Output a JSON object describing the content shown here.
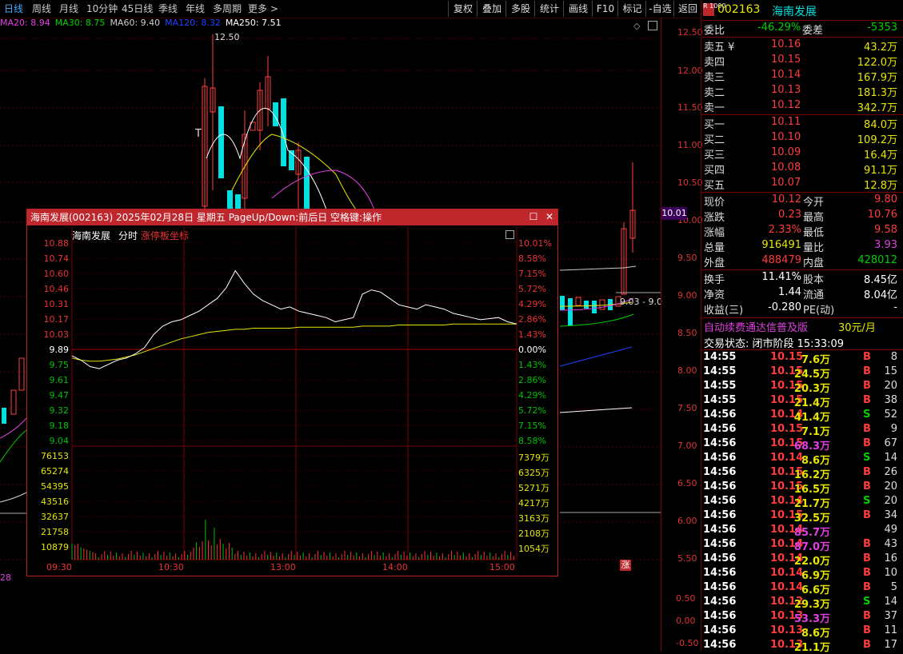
{
  "topbar": {
    "tabs": [
      "日线",
      "周线",
      "月线",
      "10分钟",
      "45日线",
      "季线",
      "年线",
      "多周期",
      "更多 >"
    ],
    "buttons": [
      "复权",
      "叠加",
      "多股",
      "统计",
      "画线",
      "F10",
      "标记",
      "-自选",
      "返回"
    ]
  },
  "ma_legend": [
    {
      "label": "MA20: 8.94",
      "color": "#e040e0"
    },
    {
      "label": "MA30: 8.75",
      "color": "#00d000"
    },
    {
      "label": "MA60: 9.40",
      "color": "#cccccc"
    },
    {
      "label": "MA120: 8.32",
      "color": "#2040ff"
    },
    {
      "label": "MA250: 7.51",
      "color": "#ffffff"
    }
  ],
  "price_axis": [
    "12.50",
    "12.00",
    "11.50",
    "11.00",
    "10.50",
    "10.00",
    "9.50",
    "9.00",
    "8.50",
    "8.00",
    "7.50",
    "7.00",
    "6.50",
    "6.00",
    "5.50",
    "0.50",
    "0.00",
    "-0.50"
  ],
  "chart_annotations": {
    "high_label": "12.50",
    "current_price_tag": "10.01",
    "range_label": "9.03 - 9.0",
    "cursor_letter": "T",
    "limit_badge": "涨",
    "macd_label": "28"
  },
  "quote": {
    "code": "002163",
    "name": "海南发展",
    "weibi_label": "委比",
    "weibi": "-46.29%",
    "weicha_label": "委差",
    "weicha": "-5353",
    "asks": [
      {
        "label": "卖五 ¥",
        "price": "10.16",
        "vol": "43.2万"
      },
      {
        "label": "卖四",
        "price": "10.15",
        "vol": "122.0万"
      },
      {
        "label": "卖三",
        "price": "10.14",
        "vol": "167.9万"
      },
      {
        "label": "卖二",
        "price": "10.13",
        "vol": "181.3万"
      },
      {
        "label": "卖一",
        "price": "10.12",
        "vol": "342.7万"
      }
    ],
    "bids": [
      {
        "label": "买一",
        "price": "10.11",
        "vol": "84.0万"
      },
      {
        "label": "买二",
        "price": "10.10",
        "vol": "109.2万"
      },
      {
        "label": "买三",
        "price": "10.09",
        "vol": "16.4万"
      },
      {
        "label": "买四",
        "price": "10.08",
        "vol": "91.1万"
      },
      {
        "label": "买五",
        "price": "10.07",
        "vol": "12.8万"
      }
    ],
    "stats": [
      {
        "l1": "现价",
        "v1": "10.12",
        "c1": "red",
        "l2": "今开",
        "v2": "9.80",
        "c2": "red"
      },
      {
        "l1": "涨跌",
        "v1": "0.23",
        "c1": "red",
        "l2": "最高",
        "v2": "10.76",
        "c2": "red"
      },
      {
        "l1": "涨幅",
        "v1": "2.33%",
        "c1": "red",
        "l2": "最低",
        "v2": "9.58",
        "c2": "red"
      },
      {
        "l1": "总量",
        "v1": "916491",
        "c1": "yellow",
        "l2": "量比",
        "v2": "3.93",
        "c2": "mag"
      },
      {
        "l1": "外盘",
        "v1": "488479",
        "c1": "red",
        "l2": "内盘",
        "v2": "428012",
        "c2": "green"
      }
    ],
    "stats2": [
      {
        "l1": "换手",
        "v1": "11.41%",
        "l2": "股本",
        "v2": "8.45亿"
      },
      {
        "l1": "净资",
        "v1": "1.44",
        "l2": "流通",
        "v2": "8.04亿"
      },
      {
        "l1": "收益(三)",
        "v1": "-0.280",
        "l2": "PE(动)",
        "v2": "-"
      }
    ],
    "ad_text": "自动续费通达信普及版",
    "ad_price": "30元/月",
    "trade_status": "交易状态: 闭市阶段 15:33:09"
  },
  "ticks": [
    {
      "t": "14:55",
      "p": "10.15",
      "v": "7.6万",
      "bs": "B",
      "n": "8"
    },
    {
      "t": "14:55",
      "p": "10.15",
      "v": "24.5万",
      "bs": "B",
      "n": "15"
    },
    {
      "t": "14:55",
      "p": "10.15",
      "v": "20.3万",
      "bs": "B",
      "n": "20"
    },
    {
      "t": "14:55",
      "p": "10.15",
      "v": "21.4万",
      "bs": "B",
      "n": "38"
    },
    {
      "t": "14:56",
      "p": "10.14",
      "v": "41.4万",
      "bs": "S",
      "n": "52"
    },
    {
      "t": "14:56",
      "p": "10.15",
      "v": "7.1万",
      "bs": "B",
      "n": "9"
    },
    {
      "t": "14:56",
      "p": "10.15",
      "v": "68.3万",
      "bs": "B",
      "n": "67"
    },
    {
      "t": "14:56",
      "p": "10.14",
      "v": "8.6万",
      "bs": "S",
      "n": "14"
    },
    {
      "t": "14:56",
      "p": "10.15",
      "v": "16.2万",
      "bs": "B",
      "n": "26"
    },
    {
      "t": "14:56",
      "p": "10.15",
      "v": "16.5万",
      "bs": "B",
      "n": "20"
    },
    {
      "t": "14:56",
      "p": "10.14",
      "v": "21.7万",
      "bs": "S",
      "n": "20"
    },
    {
      "t": "14:56",
      "p": "10.15",
      "v": "32.5万",
      "bs": "B",
      "n": "34"
    },
    {
      "t": "14:56",
      "p": "10.14",
      "v": "85.7万",
      "bs": "",
      "n": "49"
    },
    {
      "t": "14:56",
      "p": "10.14",
      "v": "87.0万",
      "bs": "B",
      "n": "43"
    },
    {
      "t": "14:56",
      "p": "10.14",
      "v": "22.0万",
      "bs": "B",
      "n": "16"
    },
    {
      "t": "14:56",
      "p": "10.14",
      "v": "6.9万",
      "bs": "B",
      "n": "10"
    },
    {
      "t": "14:56",
      "p": "10.14",
      "v": "6.6万",
      "bs": "B",
      "n": "5"
    },
    {
      "t": "14:56",
      "p": "10.12",
      "v": "29.3万",
      "bs": "S",
      "n": "14"
    },
    {
      "t": "14:56",
      "p": "10.13",
      "v": "53.3万",
      "bs": "B",
      "n": "37"
    },
    {
      "t": "14:56",
      "p": "10.13",
      "v": "8.6万",
      "bs": "B",
      "n": "11"
    },
    {
      "t": "14:56",
      "p": "10.13",
      "v": "21.1万",
      "bs": "B",
      "n": "17"
    }
  ],
  "popup": {
    "title": "海南发展(002163) 2025年02月28日 星期五 PageUp/Down:前后日 空格键:操作",
    "subtitle_name": "海南发展",
    "subtitle_mode": "分时",
    "subtitle_hint": "涨停板坐标",
    "price_left": [
      "10.88",
      "10.74",
      "10.60",
      "10.46",
      "10.31",
      "10.17",
      "10.03",
      "9.89",
      "9.75",
      "9.61",
      "9.47",
      "9.32",
      "9.18",
      "9.04"
    ],
    "pct_right": [
      "10.01%",
      "8.58%",
      "7.15%",
      "5.72%",
      "4.29%",
      "2.86%",
      "1.43%",
      "0.00%",
      "1.43%",
      "2.86%",
      "4.29%",
      "5.72%",
      "7.15%",
      "8.58%"
    ],
    "vol_left": [
      "76153",
      "65274",
      "54395",
      "43516",
      "32637",
      "21758",
      "10879"
    ],
    "vol_right": [
      "7379万",
      "6325万",
      "5271万",
      "4217万",
      "3163万",
      "2108万",
      "1054万"
    ],
    "times": [
      "09:30",
      "10:30",
      "13:00",
      "14:00",
      "15:00"
    ]
  },
  "chart_data": {
    "type": "line",
    "title": "海南发展(002163) 分时",
    "prev_close": 9.89,
    "ylim": [
      9.04,
      10.88
    ],
    "price": [
      9.82,
      9.78,
      9.72,
      9.7,
      9.74,
      9.78,
      9.8,
      9.84,
      9.9,
      10.02,
      10.1,
      10.14,
      10.16,
      10.2,
      10.24,
      10.3,
      10.36,
      10.46,
      10.62,
      10.5,
      10.4,
      10.34,
      10.3,
      10.26,
      10.28,
      10.24,
      10.22,
      10.2,
      10.18,
      10.14,
      10.16,
      10.18,
      10.4,
      10.44,
      10.42,
      10.36,
      10.3,
      10.28,
      10.26,
      10.3,
      10.28,
      10.26,
      10.22,
      10.2,
      10.18,
      10.16,
      10.17,
      10.18,
      10.14,
      10.12
    ],
    "avg": [
      9.8,
      9.78,
      9.77,
      9.77,
      9.78,
      9.79,
      9.81,
      9.83,
      9.86,
      9.89,
      9.92,
      9.95,
      9.98,
      10.0,
      10.02,
      10.04,
      10.05,
      10.06,
      10.07,
      10.07,
      10.08,
      10.08,
      10.08,
      10.08,
      10.08,
      10.09,
      10.09,
      10.09,
      10.09,
      10.09,
      10.09,
      10.09,
      10.1,
      10.1,
      10.1,
      10.1,
      10.11,
      10.11,
      10.11,
      10.11,
      10.11,
      10.11,
      10.12,
      10.12,
      10.12,
      10.12,
      10.12,
      10.12,
      10.12,
      10.12
    ]
  }
}
